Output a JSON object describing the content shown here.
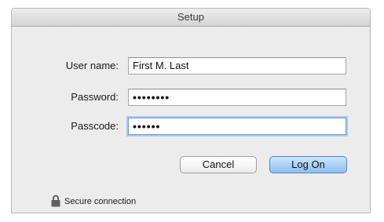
{
  "window": {
    "title": "Setup"
  },
  "form": {
    "username": {
      "label": "User name:",
      "value": "First M. Last"
    },
    "password": {
      "label": "Password:",
      "value": "••••••••"
    },
    "passcode": {
      "label": "Passcode:",
      "value": "••••••"
    }
  },
  "buttons": {
    "cancel_label": "Cancel",
    "logon_label": "Log On"
  },
  "status": {
    "secure_text": "Secure connection",
    "icon": "lock-icon"
  },
  "colors": {
    "accent": "#6a9fdc",
    "default_button": "#8fbef2"
  }
}
